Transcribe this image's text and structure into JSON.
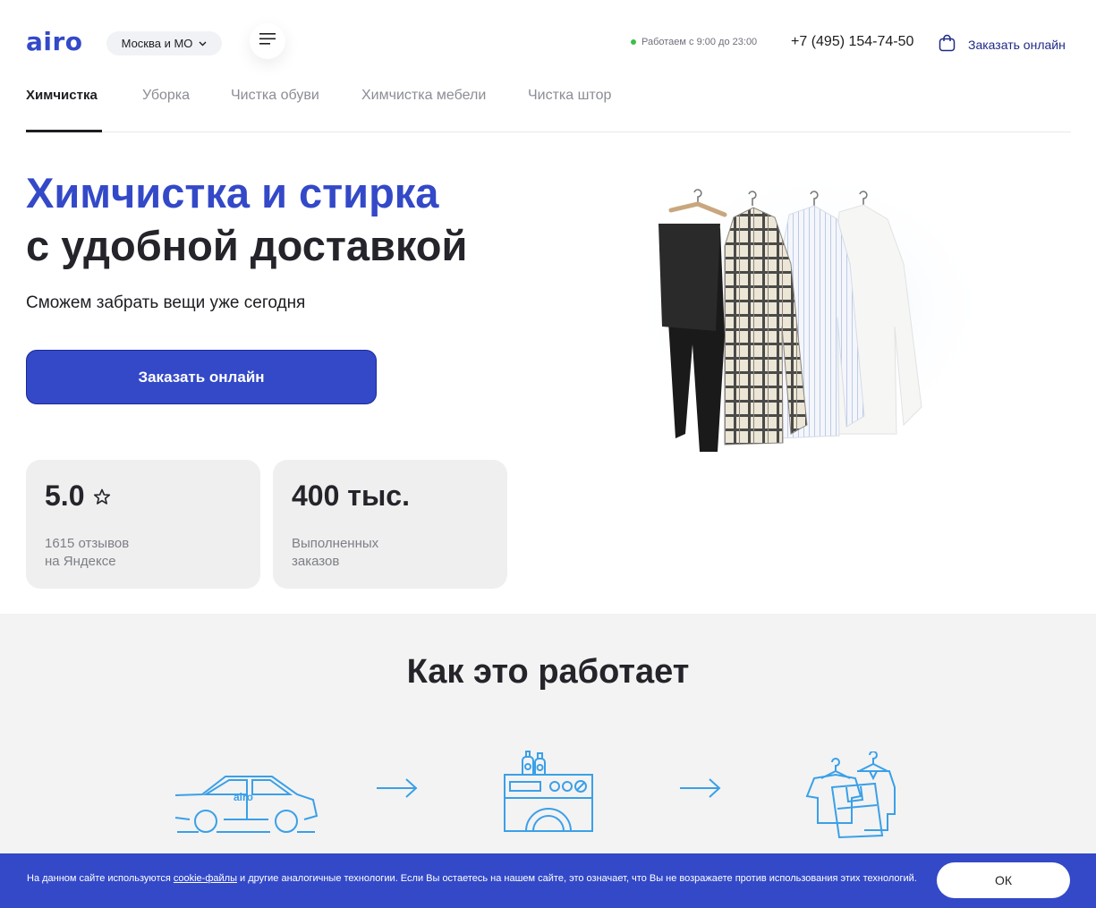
{
  "header": {
    "logo": "airo",
    "city": "Москва и МО",
    "hours": "Работаем с 9:00 до 23:00",
    "phone": "+7 (495) 154-74-50",
    "order_link": "Заказать онлайн"
  },
  "tabs": [
    {
      "label": "Химчистка",
      "active": true
    },
    {
      "label": "Уборка"
    },
    {
      "label": "Чистка обуви"
    },
    {
      "label": "Химчистка мебели"
    },
    {
      "label": "Чистка штор"
    }
  ],
  "hero": {
    "title_line1": "Химчистка и стирка",
    "title_line2": "с удобной доставкой",
    "subtitle": "Сможем забрать вещи уже сегодня",
    "cta": "Заказать онлайн"
  },
  "stats": [
    {
      "value": "5.0",
      "line1": "1615 отзывов",
      "line2": "на Яндексе"
    },
    {
      "value": "400 тыс.",
      "line1": "Выполненных",
      "line2": "заказов"
    }
  ],
  "how": {
    "title": "Как это работает",
    "car_label": "airo"
  },
  "cookie": {
    "text_before": "На данном сайте используются ",
    "link": "cookie-файлы",
    "text_after": " и другие аналогичные технологии. Если Вы остаетесь на нашем сайте, это означает, что Вы не возражаете против использования этих технологий.",
    "ok": "ОК"
  },
  "colors": {
    "brand": "#3349c8",
    "icon_blue": "#3aa0e8",
    "status_green": "#3bbf4a"
  }
}
